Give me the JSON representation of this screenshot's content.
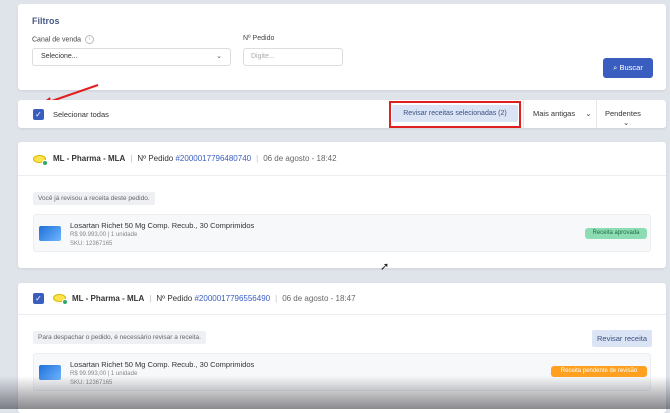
{
  "filters": {
    "title": "Filtros",
    "canal_label": "Canal de venda",
    "canal_value": "Selecione...",
    "pedido_label": "Nº Pedido",
    "pedido_placeholder": "Digite...",
    "search_button": "Buscar"
  },
  "toolbar": {
    "select_all": "Selecionar todas",
    "review_selected": "Revisar receitas selecionadas (2)",
    "sort": "Mais antigas",
    "status": "Pendentes"
  },
  "orders": [
    {
      "store": "ML - Pharma - MLA",
      "pedido_label": "Nº Pedido",
      "number": "#2000017796480740",
      "date": "06 de agosto - 18:42",
      "note": "Você já revisou a receita deste pedido.",
      "product": "Losartan Richet 50 Mg Comp. Recub., 30 Comprimidos",
      "price": "R$ 99.993,00 | 1 unidade",
      "sku": "SKU: 12367165",
      "badge": "Receita aprovada"
    },
    {
      "store": "ML - Pharma - MLA",
      "pedido_label": "Nº Pedido",
      "number": "#2000017796556490",
      "date": "06 de agosto - 18:47",
      "note": "Para despachar o pedido, é necessário revisar a receita.",
      "review_button": "Revisar receita",
      "product": "Losartan Richet 50 Mg Comp. Recub., 30 Comprimidos",
      "price": "R$ 99.993,00 | 1 unidade",
      "sku": "SKU: 12367165",
      "badge": "Receita pendente de revisão"
    }
  ],
  "colors": {
    "accent": "#3a5ec0",
    "approved": "#8edcb3",
    "pending": "#ffa020",
    "highlight": "#e02020"
  }
}
